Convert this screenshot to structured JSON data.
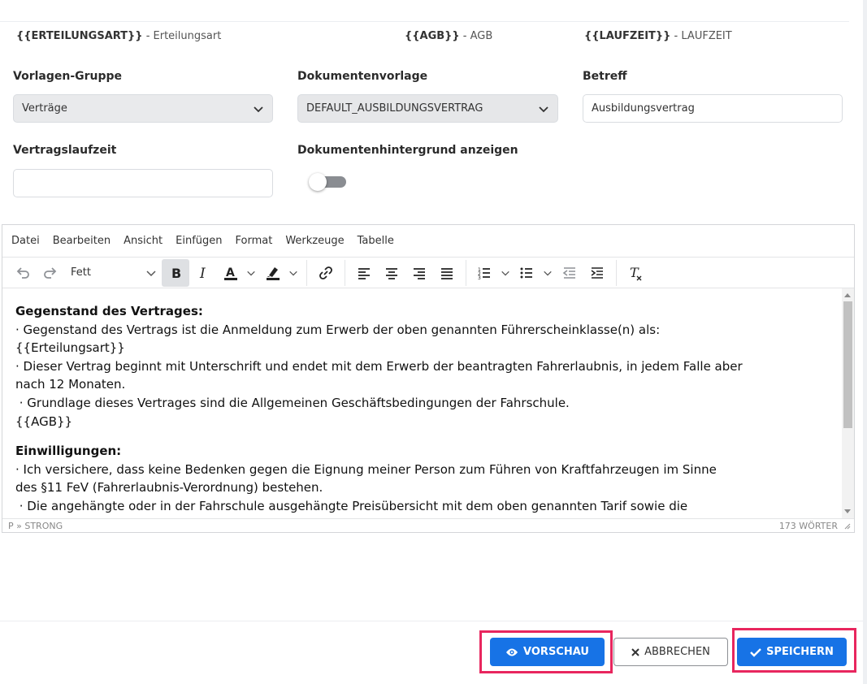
{
  "placeholders": [
    {
      "token": "{{ERTEILUNGSART}}",
      "desc": "Erteilungsart"
    },
    {
      "token": "{{AGB}}",
      "desc": "AGB"
    },
    {
      "token": "{{LAUFZEIT}}",
      "desc": "LAUFZEIT"
    }
  ],
  "form": {
    "vorlagen_gruppe_label": "Vorlagen-Gruppe",
    "vorlagen_gruppe_value": "Verträge",
    "dokumentenvorlage_label": "Dokumentenvorlage",
    "dokumentenvorlage_value": "DEFAULT_AUSBILDUNGSVERTRAG",
    "betreff_label": "Betreff",
    "betreff_value": "Ausbildungsvertrag",
    "vertragslaufzeit_label": "Vertragslaufzeit",
    "vertragslaufzeit_value": "",
    "hintergrund_label": "Dokumentenhintergrund anzeigen",
    "hintergrund_on": false
  },
  "editor": {
    "menu": [
      "Datei",
      "Bearbeiten",
      "Ansicht",
      "Einfügen",
      "Format",
      "Werkzeuge",
      "Tabelle"
    ],
    "format_value": "Fett",
    "content": {
      "heading1": "Gegenstand des Vertrages:",
      "p1": "· Gegenstand des Vertrags ist die Anmeldung zum Erwerb der oben genannten Führerscheinklasse(n) als:",
      "p2": "{{Erteilungsart}}",
      "p3": "· Dieser Vertrag beginnt mit Unterschrift und endet mit dem Erwerb der beantragten Fahrerlaubnis, in jedem Falle aber",
      "p4": "nach 12 Monaten.",
      "p5": " · Grundlage dieses Vertrages sind die Allgemeinen Geschäftsbedingungen der Fahrschule.",
      "p6": "{{AGB}}",
      "heading2": "Einwilligungen:",
      "p7": "· Ich versichere, dass keine Bedenken gegen die Eignung meiner Person zum Führen von Kraftfahrzeugen im Sinne",
      "p8": "des §11 FeV (Fahrerlaubnis-Verordnung) bestehen.",
      "p9": " · Die angehängte oder in der Fahrschule ausgehängte Preisübersicht mit dem oben genannten Tarif sowie die"
    },
    "status_path": "P » STRONG",
    "word_count": "173 WÖRTER"
  },
  "buttons": {
    "vorschau": "VORSCHAU",
    "abbrechen": "ABBRECHEN",
    "speichern": "SPEICHERN"
  },
  "colors": {
    "primary": "#1773e6",
    "highlight": "#e8265e"
  }
}
